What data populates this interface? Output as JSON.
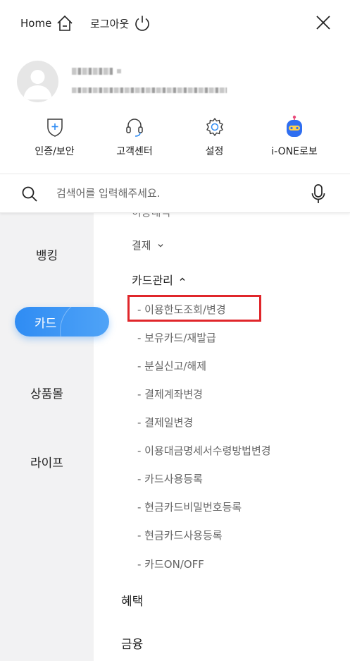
{
  "topbar": {
    "home_label": "Home",
    "logout_label": "로그아웃"
  },
  "quick_menu": [
    {
      "label": "인증/보안",
      "icon": "shield-plus-icon"
    },
    {
      "label": "고객센터",
      "icon": "headset-icon"
    },
    {
      "label": "설정",
      "icon": "gear-icon"
    },
    {
      "label": "i-ONE로보",
      "icon": "robot-icon"
    }
  ],
  "search": {
    "placeholder": "검색어를 입력해주세요."
  },
  "leftnav": {
    "items": [
      "뱅킹",
      "카드",
      "상품몰",
      "라이프"
    ],
    "active": "카드"
  },
  "content": {
    "cut_item": "이용내역",
    "groups": [
      {
        "label": "결제",
        "state": "collapsed"
      },
      {
        "label": "카드관리",
        "state": "expanded"
      }
    ],
    "card_mgmt_items": [
      "- 이용한도조회/변경",
      "- 보유카드/재발급",
      "- 분실신고/해제",
      "- 결제계좌변경",
      "- 결제일변경",
      "- 이용대금명세서수령방법변경",
      "- 카드사용등록",
      "- 현금카드비밀번호등록",
      "- 현금카드사용등록",
      "- 카드ON/OFF"
    ],
    "categories": [
      "혜택",
      "금융"
    ]
  },
  "colors": {
    "accent": "#2f8cf3",
    "highlight_box": "#e0262b",
    "nav_bg": "#f2f2f3"
  }
}
